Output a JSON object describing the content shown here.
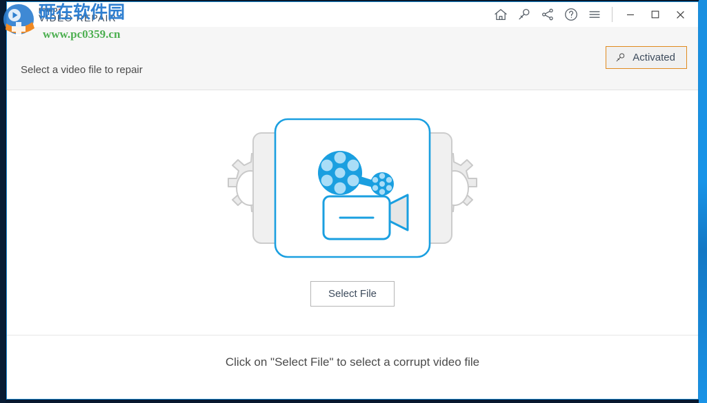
{
  "window": {
    "brand_prefix": "remo",
    "brand_dot": "▪",
    "brand_product": "VIDEO REPAIR",
    "accent_blue": "#1a8ad4",
    "header_bg": "#f6f6f6"
  },
  "titlebar": {
    "icons": [
      {
        "name": "home-icon",
        "label": "Home"
      },
      {
        "name": "key-icon",
        "label": "Activate"
      },
      {
        "name": "share-icon",
        "label": "Share"
      },
      {
        "name": "help-icon",
        "label": "Help"
      },
      {
        "name": "menu-icon",
        "label": "Menu"
      }
    ],
    "minimize_label": "Minimize",
    "maximize_label": "Maximize",
    "close_label": "Close"
  },
  "header": {
    "subtitle": "Select a video file to repair",
    "activated_label": "Activated",
    "activated_border_color": "#e08a1e"
  },
  "watermark": {
    "chinese_text": "砸在软件园",
    "url": "www.pc0359.cn",
    "url_color": "#4caf50",
    "text_color": "#2f7fd0"
  },
  "main": {
    "select_file_label": "Select File",
    "hint": "Click on \"Select File\" to select a corrupt video file",
    "illustration": {
      "name": "video-repair-illustration",
      "card_border_color": "#1a9fe0",
      "gear_fill": "#ebebeb",
      "gear_stroke": "#c9c9c9",
      "panel_fill": "#f0f0f0",
      "camera_color": "#1a9fe0",
      "lens_fill": "#e6e6e6",
      "reel_hole_color": "#a9ddf7"
    }
  }
}
